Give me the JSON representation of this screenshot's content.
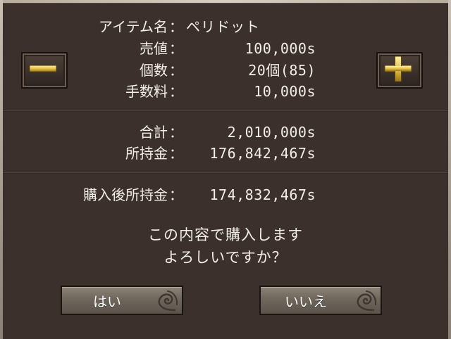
{
  "item": {
    "name_label": "アイテム名",
    "name_value": "ペリドット",
    "price_label": "売値",
    "price_value": "100,000s",
    "quantity_label": "個数",
    "quantity_value": "20個(85)",
    "fee_label": "手数料",
    "fee_value": "10,000s"
  },
  "totals": {
    "total_label": "合計",
    "total_value": "2,010,000s",
    "money_label": "所持金",
    "money_value": "176,842,467s"
  },
  "after": {
    "label": "購入後所持金",
    "value": "174,832,467s"
  },
  "colon": "：",
  "confirm": {
    "line1": "この内容で購入します",
    "line2": "よろしいですか？"
  },
  "buttons": {
    "yes": "はい",
    "no": "いいえ"
  },
  "colors": {
    "background": "#3b302c",
    "text": "#f2eee8",
    "gold_accent": "#e8c34a",
    "button_face": "#7a7167"
  },
  "icons": {
    "decrease": "minus-icon",
    "increase": "plus-icon",
    "button_ornament": "swirl-ornament-icon"
  }
}
